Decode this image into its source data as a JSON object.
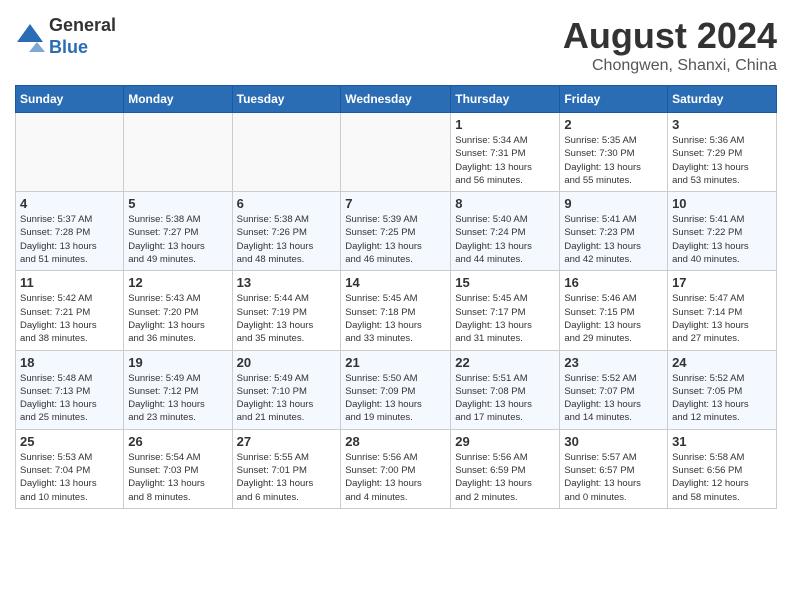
{
  "header": {
    "logo_line1": "General",
    "logo_line2": "Blue",
    "title": "August 2024",
    "subtitle": "Chongwen, Shanxi, China"
  },
  "calendar": {
    "days_of_week": [
      "Sunday",
      "Monday",
      "Tuesday",
      "Wednesday",
      "Thursday",
      "Friday",
      "Saturday"
    ],
    "weeks": [
      [
        {
          "day": "",
          "info": ""
        },
        {
          "day": "",
          "info": ""
        },
        {
          "day": "",
          "info": ""
        },
        {
          "day": "",
          "info": ""
        },
        {
          "day": "1",
          "info": "Sunrise: 5:34 AM\nSunset: 7:31 PM\nDaylight: 13 hours\nand 56 minutes."
        },
        {
          "day": "2",
          "info": "Sunrise: 5:35 AM\nSunset: 7:30 PM\nDaylight: 13 hours\nand 55 minutes."
        },
        {
          "day": "3",
          "info": "Sunrise: 5:36 AM\nSunset: 7:29 PM\nDaylight: 13 hours\nand 53 minutes."
        }
      ],
      [
        {
          "day": "4",
          "info": "Sunrise: 5:37 AM\nSunset: 7:28 PM\nDaylight: 13 hours\nand 51 minutes."
        },
        {
          "day": "5",
          "info": "Sunrise: 5:38 AM\nSunset: 7:27 PM\nDaylight: 13 hours\nand 49 minutes."
        },
        {
          "day": "6",
          "info": "Sunrise: 5:38 AM\nSunset: 7:26 PM\nDaylight: 13 hours\nand 48 minutes."
        },
        {
          "day": "7",
          "info": "Sunrise: 5:39 AM\nSunset: 7:25 PM\nDaylight: 13 hours\nand 46 minutes."
        },
        {
          "day": "8",
          "info": "Sunrise: 5:40 AM\nSunset: 7:24 PM\nDaylight: 13 hours\nand 44 minutes."
        },
        {
          "day": "9",
          "info": "Sunrise: 5:41 AM\nSunset: 7:23 PM\nDaylight: 13 hours\nand 42 minutes."
        },
        {
          "day": "10",
          "info": "Sunrise: 5:41 AM\nSunset: 7:22 PM\nDaylight: 13 hours\nand 40 minutes."
        }
      ],
      [
        {
          "day": "11",
          "info": "Sunrise: 5:42 AM\nSunset: 7:21 PM\nDaylight: 13 hours\nand 38 minutes."
        },
        {
          "day": "12",
          "info": "Sunrise: 5:43 AM\nSunset: 7:20 PM\nDaylight: 13 hours\nand 36 minutes."
        },
        {
          "day": "13",
          "info": "Sunrise: 5:44 AM\nSunset: 7:19 PM\nDaylight: 13 hours\nand 35 minutes."
        },
        {
          "day": "14",
          "info": "Sunrise: 5:45 AM\nSunset: 7:18 PM\nDaylight: 13 hours\nand 33 minutes."
        },
        {
          "day": "15",
          "info": "Sunrise: 5:45 AM\nSunset: 7:17 PM\nDaylight: 13 hours\nand 31 minutes."
        },
        {
          "day": "16",
          "info": "Sunrise: 5:46 AM\nSunset: 7:15 PM\nDaylight: 13 hours\nand 29 minutes."
        },
        {
          "day": "17",
          "info": "Sunrise: 5:47 AM\nSunset: 7:14 PM\nDaylight: 13 hours\nand 27 minutes."
        }
      ],
      [
        {
          "day": "18",
          "info": "Sunrise: 5:48 AM\nSunset: 7:13 PM\nDaylight: 13 hours\nand 25 minutes."
        },
        {
          "day": "19",
          "info": "Sunrise: 5:49 AM\nSunset: 7:12 PM\nDaylight: 13 hours\nand 23 minutes."
        },
        {
          "day": "20",
          "info": "Sunrise: 5:49 AM\nSunset: 7:10 PM\nDaylight: 13 hours\nand 21 minutes."
        },
        {
          "day": "21",
          "info": "Sunrise: 5:50 AM\nSunset: 7:09 PM\nDaylight: 13 hours\nand 19 minutes."
        },
        {
          "day": "22",
          "info": "Sunrise: 5:51 AM\nSunset: 7:08 PM\nDaylight: 13 hours\nand 17 minutes."
        },
        {
          "day": "23",
          "info": "Sunrise: 5:52 AM\nSunset: 7:07 PM\nDaylight: 13 hours\nand 14 minutes."
        },
        {
          "day": "24",
          "info": "Sunrise: 5:52 AM\nSunset: 7:05 PM\nDaylight: 13 hours\nand 12 minutes."
        }
      ],
      [
        {
          "day": "25",
          "info": "Sunrise: 5:53 AM\nSunset: 7:04 PM\nDaylight: 13 hours\nand 10 minutes."
        },
        {
          "day": "26",
          "info": "Sunrise: 5:54 AM\nSunset: 7:03 PM\nDaylight: 13 hours\nand 8 minutes."
        },
        {
          "day": "27",
          "info": "Sunrise: 5:55 AM\nSunset: 7:01 PM\nDaylight: 13 hours\nand 6 minutes."
        },
        {
          "day": "28",
          "info": "Sunrise: 5:56 AM\nSunset: 7:00 PM\nDaylight: 13 hours\nand 4 minutes."
        },
        {
          "day": "29",
          "info": "Sunrise: 5:56 AM\nSunset: 6:59 PM\nDaylight: 13 hours\nand 2 minutes."
        },
        {
          "day": "30",
          "info": "Sunrise: 5:57 AM\nSunset: 6:57 PM\nDaylight: 13 hours\nand 0 minutes."
        },
        {
          "day": "31",
          "info": "Sunrise: 5:58 AM\nSunset: 6:56 PM\nDaylight: 12 hours\nand 58 minutes."
        }
      ]
    ]
  }
}
